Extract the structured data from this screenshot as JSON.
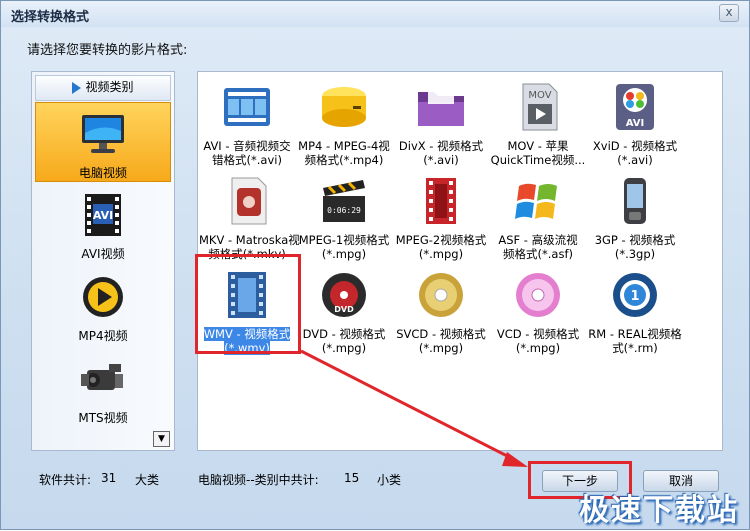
{
  "window": {
    "title": "选择转换格式",
    "close_label": "x"
  },
  "prompt": "请选择您要转换的影片格式:",
  "sidebar": {
    "header": "视频类别",
    "items": [
      {
        "label": "电脑视频",
        "icon": "monitor-icon",
        "selected": true
      },
      {
        "label": "AVI视频",
        "icon": "avi-film-icon"
      },
      {
        "label": "MP4视频",
        "icon": "mp4-play-icon"
      },
      {
        "label": "MTS视频",
        "icon": "camcorder-icon"
      }
    ]
  },
  "formats": [
    {
      "label1": "AVI - 音频视频交",
      "label2": "错格式(*.avi)",
      "icon": "film-strip-icon"
    },
    {
      "label1": "MP4 - MPEG-4视",
      "label2": "频格式(*.mp4)",
      "icon": "yellow-drive-icon"
    },
    {
      "label1": "DivX - 视频格式",
      "label2": "(*.avi)",
      "icon": "purple-folder-icon"
    },
    {
      "label1": "MOV - 苹果",
      "label2": "QuickTime视频...",
      "icon": "mov-file-icon"
    },
    {
      "label1": "XviD - 视频格式",
      "label2": "(*.avi)",
      "icon": "xvid-avi-icon"
    },
    {
      "label1": "MKV - Matroska视",
      "label2": "频格式(*.mkv)",
      "icon": "mkv-file-icon"
    },
    {
      "label1": "MPEG-1视频格式",
      "label2": "(*.mpg)",
      "icon": "clapperboard-icon"
    },
    {
      "label1": "MPEG-2视频格式",
      "label2": "(*.mpg)",
      "icon": "red-film-icon"
    },
    {
      "label1": "ASF - 高级流视",
      "label2": "频格式(*.asf)",
      "icon": "windows-logo-icon"
    },
    {
      "label1": "3GP - 视频格式",
      "label2": "(*.3gp)",
      "icon": "phone-icon"
    },
    {
      "label1": "WMV - 视频格式",
      "label2": "(*.wmv)",
      "icon": "wmv-film-icon",
      "selected": true
    },
    {
      "label1": "DVD - 视频格式",
      "label2": "(*.mpg)",
      "icon": "dvd-disc-icon"
    },
    {
      "label1": "SVCD - 视频格式",
      "label2": "(*.mpg)",
      "icon": "gold-disc-icon"
    },
    {
      "label1": "VCD - 视频格式",
      "label2": "(*.mpg)",
      "icon": "pink-disc-icon"
    },
    {
      "label1": "RM - REAL视频格",
      "label2": "式(*.rm)",
      "icon": "realplayer-icon"
    }
  ],
  "footer": {
    "software_total_label": "软件共计:",
    "software_total_value": "31",
    "software_total_unit": "大类",
    "category_total_label": "电脑视频--类别中共计:",
    "category_total_value": "15",
    "category_total_unit": "小类",
    "next_button": "下一步",
    "cancel_button": "取消"
  },
  "watermark": "极速下载站",
  "colors": {
    "highlight": "#e0262a",
    "selection": "#3d87e6",
    "sidebar_selected": "#f7a91a"
  }
}
